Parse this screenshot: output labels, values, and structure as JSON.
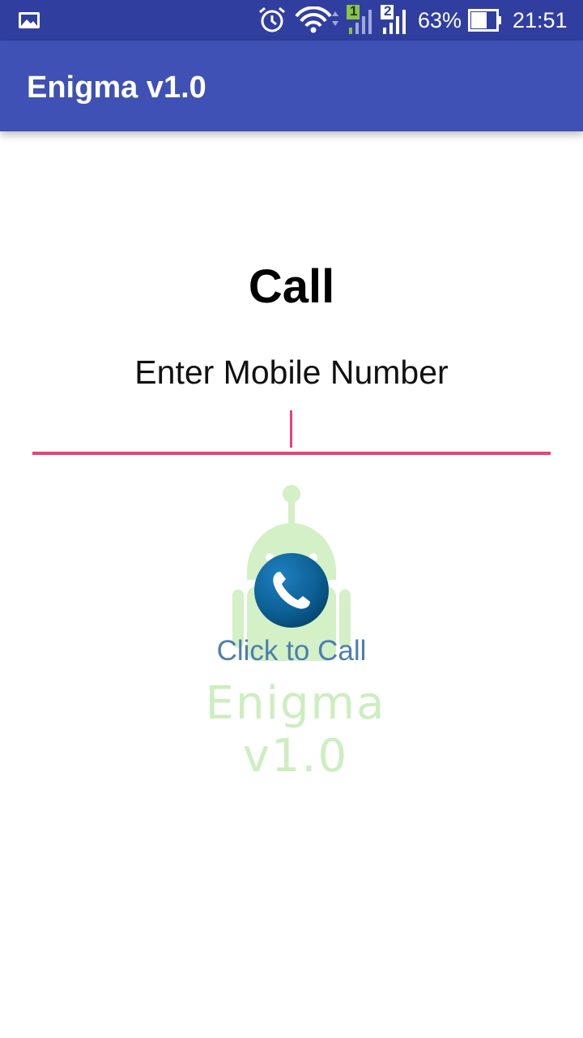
{
  "status_bar": {
    "battery_percent": "63%",
    "time": "21:51",
    "sim1_label": "1",
    "sim2_label": "2",
    "icons": [
      "gallery-icon",
      "alarm-icon",
      "wifi-icon",
      "signal-sim1-icon",
      "signal-sim2-icon",
      "battery-icon"
    ]
  },
  "app_bar": {
    "title": "Enigma v1.0"
  },
  "main": {
    "heading": "Call",
    "input_label": "Enter Mobile Number",
    "input_value": "",
    "input_placeholder": "",
    "call_button_label": "Click to Call",
    "watermark_text": "Enigma v1.0"
  },
  "colors": {
    "status_bar": "#303F9F",
    "app_bar": "#3F51B5",
    "accent": "#EC407A",
    "call_link": "#4D7EAE",
    "watermark": "#cdeec0"
  }
}
